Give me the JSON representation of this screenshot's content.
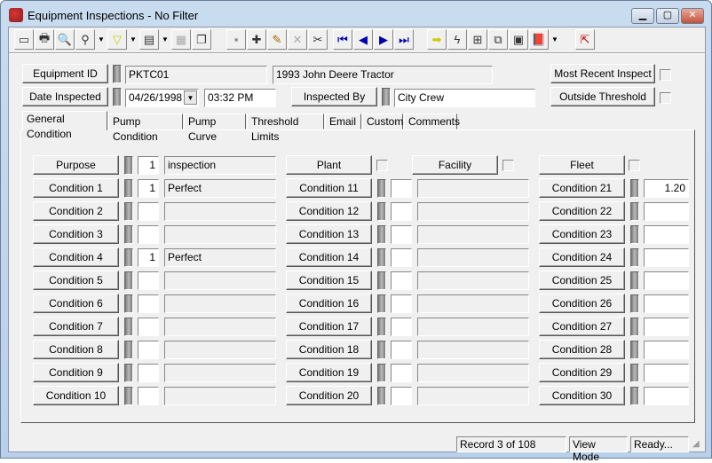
{
  "window": {
    "title": "Equipment Inspections - No Filter"
  },
  "toolbar": {
    "icons": [
      "select-record-icon",
      "print-icon",
      "preview-icon",
      "find-icon",
      "filter-icon",
      "report-icon",
      "properties-icon",
      "copy-icon",
      "save-icon",
      "add-record-icon",
      "edit-icon",
      "delete-icon",
      "cut-icon",
      "first-record-icon",
      "prev-record-icon",
      "next-record-icon",
      "last-record-icon",
      "goto-icon",
      "quick-icon",
      "hierarchy-icon",
      "link-icon",
      "map-icon",
      "help-book-icon",
      "exit-icon"
    ]
  },
  "header": {
    "equipment_id_label": "Equipment ID",
    "equipment_id": "PKTC01",
    "equipment_desc": "1993 John Deere Tractor",
    "date_inspected_label": "Date Inspected",
    "date": "04/26/1998",
    "time": "03:32 PM",
    "inspected_by_label": "Inspected By",
    "inspected_by": "City Crew",
    "most_recent_label": "Most Recent Inspect",
    "outside_threshold_label": "Outside Threshold"
  },
  "tabs": [
    "General Condition",
    "Pump Condition",
    "Pump Curve",
    "Threshold Limits",
    "Email",
    "Custom",
    "Comments"
  ],
  "general": {
    "purpose": {
      "label": "Purpose",
      "code": "1",
      "text": "inspection"
    },
    "plant_label": "Plant",
    "facility_label": "Facility",
    "fleet_label": "Fleet",
    "col1": [
      {
        "label": "Condition 1",
        "code": "1",
        "text": "Perfect"
      },
      {
        "label": "Condition 2",
        "code": "",
        "text": ""
      },
      {
        "label": "Condition 3",
        "code": "",
        "text": ""
      },
      {
        "label": "Condition 4",
        "code": "1",
        "text": "Perfect"
      },
      {
        "label": "Condition 5",
        "code": "",
        "text": ""
      },
      {
        "label": "Condition 6",
        "code": "",
        "text": ""
      },
      {
        "label": "Condition 7",
        "code": "",
        "text": ""
      },
      {
        "label": "Condition 8",
        "code": "",
        "text": ""
      },
      {
        "label": "Condition 9",
        "code": "",
        "text": ""
      },
      {
        "label": "Condition 10",
        "code": "",
        "text": ""
      }
    ],
    "col2": [
      {
        "label": "Condition 11",
        "code": "",
        "text": ""
      },
      {
        "label": "Condition 12",
        "code": "",
        "text": ""
      },
      {
        "label": "Condition 13",
        "code": "",
        "text": ""
      },
      {
        "label": "Condition 14",
        "code": "",
        "text": ""
      },
      {
        "label": "Condition 15",
        "code": "",
        "text": ""
      },
      {
        "label": "Condition 16",
        "code": "",
        "text": ""
      },
      {
        "label": "Condition 17",
        "code": "",
        "text": ""
      },
      {
        "label": "Condition 18",
        "code": "",
        "text": ""
      },
      {
        "label": "Condition 19",
        "code": "",
        "text": ""
      },
      {
        "label": "Condition 20",
        "code": "",
        "text": ""
      }
    ],
    "col3": [
      {
        "label": "Condition 21",
        "value": "1.20"
      },
      {
        "label": "Condition 22",
        "value": ""
      },
      {
        "label": "Condition 23",
        "value": ""
      },
      {
        "label": "Condition 24",
        "value": ""
      },
      {
        "label": "Condition 25",
        "value": ""
      },
      {
        "label": "Condition 26",
        "value": ""
      },
      {
        "label": "Condition 27",
        "value": ""
      },
      {
        "label": "Condition 28",
        "value": ""
      },
      {
        "label": "Condition 29",
        "value": ""
      },
      {
        "label": "Condition 30",
        "value": ""
      }
    ]
  },
  "status": {
    "record": "Record 3 of 108",
    "mode": "View Mode",
    "state": "Ready..."
  }
}
